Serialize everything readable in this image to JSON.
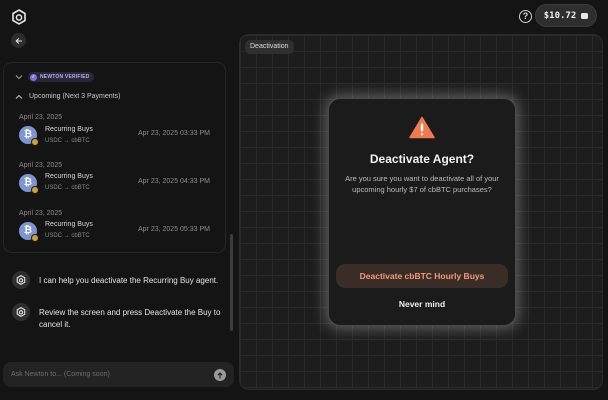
{
  "header": {
    "logo_icon": "newton-logo-icon",
    "help_icon": "question-circle-icon",
    "help_glyph": "?",
    "wallet_amount": "$10.72",
    "wallet_icon": "wallet-icon"
  },
  "left_panel": {
    "back_icon": "arrow-left-icon",
    "verified_badge": "NEWTON VERIFIED",
    "upcoming_label": "Upcoming (Next 3 Payments)",
    "payments": [
      {
        "date": "April 23, 2025",
        "name": "Recurring Buys",
        "pair": "USDC → cbBTC",
        "time": "Apr 23, 2025 03:33 PM",
        "coin_glyph": "₿"
      },
      {
        "date": "April 23, 2025",
        "name": "Recurring Buys",
        "pair": "USDC → cbBTC",
        "time": "Apr 23, 2025 04:33 PM",
        "coin_glyph": "₿"
      },
      {
        "date": "April 23, 2025",
        "name": "Recurring Buys",
        "pair": "USDC → cbBTC",
        "time": "Apr 23, 2025 05:33 PM",
        "coin_glyph": "₿"
      }
    ],
    "messages": [
      {
        "text": "I can help you deactivate the Recurring Buy agent."
      },
      {
        "text": "Review the screen and press Deactivate the Buy to cancel it."
      }
    ],
    "input_placeholder": "Ask Newton to... (Coming soon)"
  },
  "right_panel": {
    "chip_label": "Deactivation",
    "modal": {
      "title": "Deactivate Agent?",
      "body": "Are you sure you want to deactivate all of your upcoming hourly $7 of cbBTC purchases?",
      "confirm_label": "Deactivate cbBTC Hourly Buys",
      "cancel_label": "Never mind",
      "warning_icon": "warning-triangle-icon"
    }
  },
  "colors": {
    "accent_orange": "#f07a50",
    "confirm_text": "#f09b78",
    "verified_purple": "#7d73d6"
  }
}
